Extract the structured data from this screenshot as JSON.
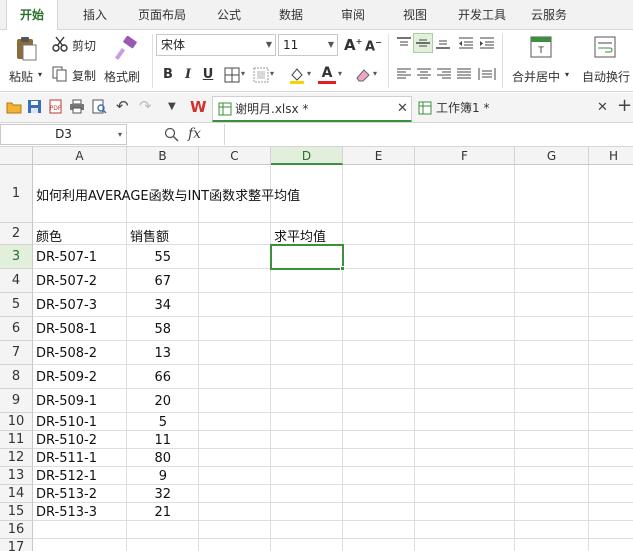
{
  "ribbon_tabs": [
    "开始",
    "插入",
    "页面布局",
    "公式",
    "数据",
    "审阅",
    "视图",
    "开发工具",
    "云服务"
  ],
  "ribbon": {
    "paste": "粘贴",
    "cut": "剪切",
    "copy": "复制",
    "format_painter": "格式刷",
    "font_name": "宋体",
    "font_size": "11",
    "bold": "B",
    "italic": "I",
    "underline": "U",
    "merge_center": "合并居中",
    "wrap_text": "自动换行"
  },
  "doc_tabs": [
    {
      "label": "谢明月.xlsx *"
    },
    {
      "label": "工作簿1 *"
    }
  ],
  "formula_bar": {
    "name_box": "D3",
    "fx": "fx",
    "value": ""
  },
  "columns": [
    "A",
    "B",
    "C",
    "D",
    "E",
    "F",
    "G",
    "H"
  ],
  "rows": [
    "1",
    "2",
    "3",
    "4",
    "5",
    "6",
    "7",
    "8",
    "9",
    "10",
    "11",
    "12",
    "13",
    "14",
    "15",
    "16",
    "17"
  ],
  "sheet": {
    "title": "如何利用AVERAGE函数与INT函数求整平均值",
    "header_color": "颜色",
    "header_sales": "销售额",
    "header_avg": "求平均值",
    "data": [
      {
        "color": "DR-507-1",
        "sales": "55"
      },
      {
        "color": "DR-507-2",
        "sales": "67"
      },
      {
        "color": "DR-507-3",
        "sales": "34"
      },
      {
        "color": "DR-508-1",
        "sales": "58"
      },
      {
        "color": "DR-508-2",
        "sales": "13"
      },
      {
        "color": "DR-509-2",
        "sales": "66"
      },
      {
        "color": "DR-509-1",
        "sales": "20"
      },
      {
        "color": "DR-510-1",
        "sales": "5"
      },
      {
        "color": "DR-510-2",
        "sales": "11"
      },
      {
        "color": "DR-511-1",
        "sales": "80"
      },
      {
        "color": "DR-512-1",
        "sales": "9"
      },
      {
        "color": "DR-513-2",
        "sales": "32"
      },
      {
        "color": "DR-513-3",
        "sales": "21"
      }
    ]
  },
  "colors": {
    "accent": "#3c8f3c",
    "selected_header": "#e2efdc"
  }
}
